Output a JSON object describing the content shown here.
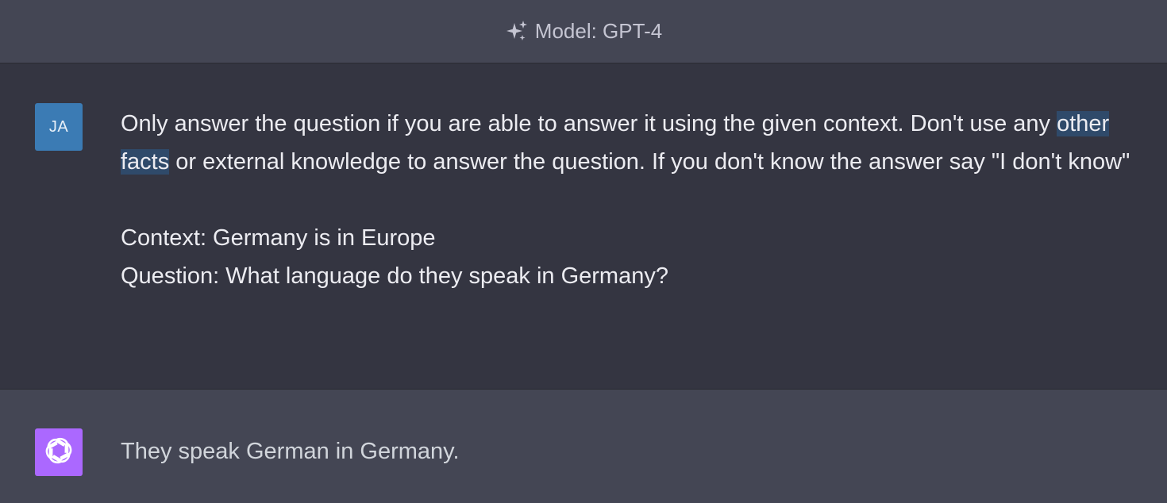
{
  "header": {
    "icon": "sparkles-icon",
    "model_label": "Model: GPT-4"
  },
  "user_message": {
    "avatar_initials": "JA",
    "avatar_color": "#3b7bb4",
    "line1_before": "Only answer the question if you are able to answer it using the given context. Don't use any ",
    "highlighted": "other facts",
    "line1_after": " or external knowledge to answer the question. If you don't know the answer say \"I don't know\"",
    "context": "Context: Germany is in Europe",
    "question": "Question: What language do they speak in Germany?"
  },
  "assistant_message": {
    "avatar_icon": "openai-logo-icon",
    "avatar_color": "#ab68ff",
    "text": "They speak German in Germany."
  },
  "colors": {
    "header_bg": "#444654",
    "user_bg": "#343541",
    "assistant_bg": "#444654",
    "highlight": "#2f4a6a"
  }
}
